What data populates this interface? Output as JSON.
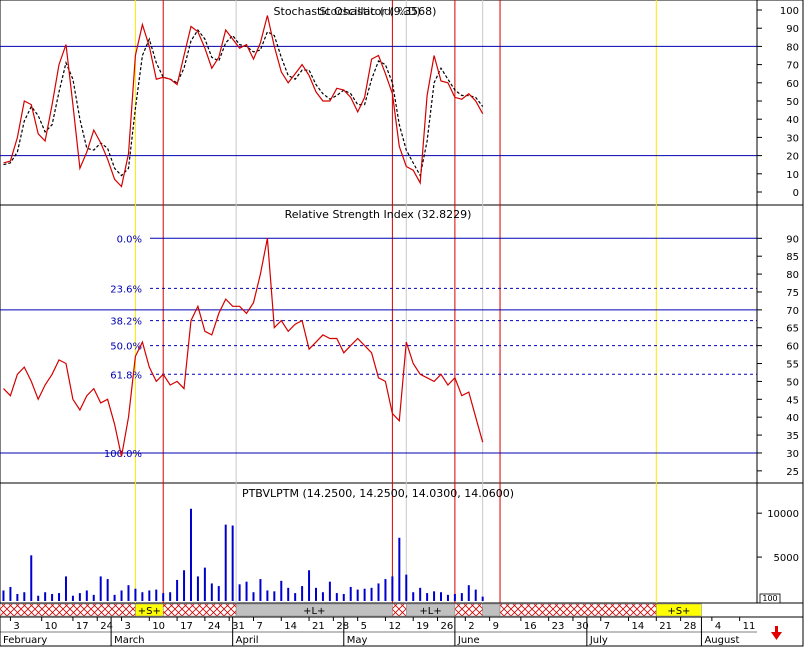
{
  "colors": {
    "price_line": "#d40000",
    "signal_line": "#000000",
    "level_line": "#0000b0",
    "volume_bar": "#0000cc",
    "marker_red": "#d40000",
    "marker_yellow": "#ffe800",
    "marker_gray": "#c8c8c8",
    "band_hatch": "#d40000",
    "band_yellow": "#ffff00",
    "band_gray": "#c0c0c0",
    "fib_label": "#0000b0",
    "down_arrow": "#e00000"
  },
  "chart_data": [
    {
      "type": "line",
      "panel": "stochastic",
      "title": "Stochastic Oscillator (9.3568)",
      "title_overlap": "Stochastic (dl %D)",
      "x": [
        1,
        3,
        5,
        7,
        9,
        11,
        13,
        15,
        17,
        19,
        21,
        23,
        25,
        27,
        29,
        31,
        33,
        35,
        37,
        39,
        41,
        43,
        45,
        47,
        49,
        51,
        53,
        55,
        57,
        59,
        61,
        63,
        65,
        67,
        69,
        71,
        73,
        75,
        77,
        79,
        81,
        83,
        85,
        87,
        89,
        91,
        93,
        95,
        97,
        99,
        101,
        103,
        105,
        107,
        109,
        111,
        113,
        115,
        117,
        119,
        121,
        123,
        125,
        127,
        129,
        131,
        133,
        135,
        137,
        139
      ],
      "series": [
        {
          "name": "%K",
          "values": [
            16,
            17,
            30,
            50,
            48,
            32,
            28,
            48,
            70,
            81,
            48,
            13,
            22,
            34,
            27,
            18,
            7,
            3,
            21,
            75,
            92,
            80,
            62,
            63,
            62,
            59,
            75,
            91,
            88,
            79,
            68,
            74,
            89,
            84,
            79,
            81,
            73,
            82,
            97,
            80,
            66,
            60,
            65,
            70,
            64,
            55,
            50,
            50,
            57,
            56,
            52,
            44,
            52,
            73,
            75,
            65,
            54,
            25,
            14,
            12,
            5,
            53,
            75,
            61,
            60,
            52,
            51,
            54,
            50,
            43
          ]
        },
        {
          "name": "%D",
          "values": [
            15,
            16,
            22,
            39,
            47,
            42,
            33,
            37,
            55,
            71,
            62,
            40,
            24,
            23,
            27,
            24,
            13,
            9,
            13,
            46,
            75,
            84,
            71,
            63,
            62,
            60,
            68,
            83,
            89,
            84,
            74,
            72,
            82,
            86,
            81,
            80,
            77,
            78,
            88,
            86,
            74,
            64,
            62,
            67,
            67,
            59,
            54,
            51,
            53,
            56,
            54,
            48,
            48,
            62,
            72,
            70,
            60,
            37,
            23,
            16,
            9,
            28,
            60,
            68,
            62,
            56,
            53,
            53,
            52,
            47
          ]
        }
      ],
      "levels": [
        80,
        20
      ],
      "ylim": [
        0,
        100
      ],
      "yticks": [
        0,
        10,
        20,
        30,
        40,
        50,
        60,
        70,
        80,
        90,
        100
      ]
    },
    {
      "type": "line",
      "panel": "rsi",
      "title": "Relative Strength Index (32.8229)",
      "x": [
        1,
        3,
        5,
        7,
        9,
        11,
        13,
        15,
        17,
        19,
        21,
        23,
        25,
        27,
        29,
        31,
        33,
        35,
        37,
        39,
        41,
        43,
        45,
        47,
        49,
        51,
        53,
        55,
        57,
        59,
        61,
        63,
        65,
        67,
        69,
        71,
        73,
        75,
        77,
        79,
        81,
        83,
        85,
        87,
        89,
        91,
        93,
        95,
        97,
        99,
        101,
        103,
        105,
        107,
        109,
        111,
        113,
        115,
        117,
        119,
        121,
        123,
        125,
        127,
        129,
        131,
        133,
        135,
        137,
        139
      ],
      "series": [
        {
          "name": "RSI",
          "values": [
            48,
            46,
            52,
            54,
            50,
            45,
            49,
            52,
            56,
            55,
            45,
            42,
            46,
            48,
            44,
            45,
            38,
            29,
            40,
            57,
            61,
            54,
            50,
            52,
            49,
            50,
            48,
            67,
            71,
            64,
            63,
            69,
            73,
            71,
            71,
            69,
            72,
            80,
            90,
            65,
            67,
            64,
            66,
            67,
            59,
            61,
            63,
            62,
            62,
            58,
            60,
            62,
            60,
            58,
            51,
            50,
            41,
            39,
            61,
            55,
            52,
            51,
            50,
            52,
            49,
            51,
            46,
            47,
            40,
            33
          ]
        }
      ],
      "fib_levels": [
        {
          "label": "0.0%",
          "value": 90
        },
        {
          "label": "23.6%",
          "value": 76
        },
        {
          "label": "38.2%",
          "value": 67
        },
        {
          "label": "50.0%",
          "value": 60
        },
        {
          "label": "61.8%",
          "value": 52
        },
        {
          "label": "100.0%",
          "value": 30
        }
      ],
      "levels": [
        70,
        30
      ],
      "ylim": [
        23,
        94
      ],
      "yticks": [
        25,
        30,
        35,
        40,
        45,
        50,
        55,
        60,
        65,
        70,
        75,
        80,
        85,
        90
      ]
    },
    {
      "type": "bar",
      "panel": "volume",
      "title": "PTBVLPTM (14.2500, 14.2500, 14.0300, 14.0600)",
      "x": [
        1,
        3,
        5,
        7,
        9,
        11,
        13,
        15,
        17,
        19,
        21,
        23,
        25,
        27,
        29,
        31,
        33,
        35,
        37,
        39,
        41,
        43,
        45,
        47,
        49,
        51,
        53,
        55,
        57,
        59,
        61,
        63,
        65,
        67,
        69,
        71,
        73,
        75,
        77,
        79,
        81,
        83,
        85,
        87,
        89,
        91,
        93,
        95,
        97,
        99,
        101,
        103,
        105,
        107,
        109,
        111,
        113,
        115,
        117,
        119,
        121,
        123,
        125,
        127,
        129,
        131,
        133,
        135,
        137,
        139
      ],
      "values": [
        1200,
        1600,
        800,
        1000,
        5200,
        600,
        1000,
        800,
        900,
        2800,
        600,
        900,
        1200,
        700,
        2800,
        2500,
        700,
        1200,
        1800,
        1400,
        1000,
        1200,
        1300,
        900,
        1000,
        2400,
        3500,
        10500,
        2800,
        3800,
        2000,
        1700,
        8700,
        8600,
        1900,
        2200,
        1000,
        2500,
        1200,
        1100,
        2300,
        1500,
        900,
        1700,
        3500,
        1500,
        1000,
        2200,
        900,
        800,
        1600,
        1300,
        1400,
        1500,
        2000,
        2500,
        2800,
        7200,
        3000,
        1000,
        1500,
        900,
        1100,
        1000,
        700,
        800,
        900,
        1800,
        1300,
        500
      ],
      "ylim": [
        0,
        11500
      ],
      "yticks": [
        5000,
        10000
      ],
      "ytick_labels": [
        "5000",
        "10000"
      ],
      "bottom_box_label": "100"
    }
  ],
  "x_axis": {
    "day_ticks": [
      {
        "x": 3,
        "label": "3"
      },
      {
        "x": 12,
        "label": "10"
      },
      {
        "x": 21,
        "label": "17"
      },
      {
        "x": 28,
        "label": "24"
      },
      {
        "x": 35,
        "label": "3"
      },
      {
        "x": 43,
        "label": "10"
      },
      {
        "x": 51,
        "label": "17"
      },
      {
        "x": 59,
        "label": "24"
      },
      {
        "x": 66,
        "label": "31"
      },
      {
        "x": 73,
        "label": "7"
      },
      {
        "x": 81,
        "label": "14"
      },
      {
        "x": 89,
        "label": "21"
      },
      {
        "x": 96,
        "label": "28"
      },
      {
        "x": 103,
        "label": "5"
      },
      {
        "x": 111,
        "label": "12"
      },
      {
        "x": 119,
        "label": "19"
      },
      {
        "x": 126,
        "label": "26"
      },
      {
        "x": 134,
        "label": "2"
      },
      {
        "x": 141,
        "label": "9"
      },
      {
        "x": 150,
        "label": "16"
      },
      {
        "x": 158,
        "label": "23"
      },
      {
        "x": 165,
        "label": "30"
      },
      {
        "x": 173,
        "label": "7"
      },
      {
        "x": 181,
        "label": "14"
      },
      {
        "x": 189,
        "label": "21"
      },
      {
        "x": 196,
        "label": "28"
      },
      {
        "x": 205,
        "label": "4"
      },
      {
        "x": 213,
        "label": "11"
      }
    ],
    "months": [
      {
        "x": 0,
        "label": "February"
      },
      {
        "x": 32,
        "label": "March"
      },
      {
        "x": 67,
        "label": "April"
      },
      {
        "x": 99,
        "label": "May"
      },
      {
        "x": 131,
        "label": "June"
      },
      {
        "x": 169,
        "label": "July"
      },
      {
        "x": 202,
        "label": "August"
      }
    ],
    "xlim": [
      0,
      218
    ]
  },
  "markers": [
    {
      "x": 39,
      "color": "yellow"
    },
    {
      "x": 47,
      "color": "red"
    },
    {
      "x": 68,
      "color": "gray"
    },
    {
      "x": 113,
      "color": "red"
    },
    {
      "x": 117,
      "color": "gray"
    },
    {
      "x": 131,
      "color": "red"
    },
    {
      "x": 139,
      "color": "gray"
    },
    {
      "x": 144,
      "color": "red"
    },
    {
      "x": 189,
      "color": "yellow"
    }
  ],
  "signal_band": [
    {
      "from": 0,
      "to": 39,
      "style": "hatch",
      "label": ""
    },
    {
      "from": 39,
      "to": 47,
      "style": "yellow",
      "label": "+S+"
    },
    {
      "from": 47,
      "to": 68,
      "style": "hatch",
      "label": ""
    },
    {
      "from": 68,
      "to": 113,
      "style": "gray",
      "label": "+L+"
    },
    {
      "from": 113,
      "to": 117,
      "style": "hatch",
      "label": ""
    },
    {
      "from": 117,
      "to": 131,
      "style": "gray",
      "label": "+L+"
    },
    {
      "from": 131,
      "to": 139,
      "style": "hatch",
      "label": ""
    },
    {
      "from": 139,
      "to": 144,
      "style": "gray",
      "label": ""
    },
    {
      "from": 144,
      "to": 189,
      "style": "hatch",
      "label": ""
    },
    {
      "from": 189,
      "to": 202,
      "style": "yellow",
      "label": "+S+"
    }
  ]
}
